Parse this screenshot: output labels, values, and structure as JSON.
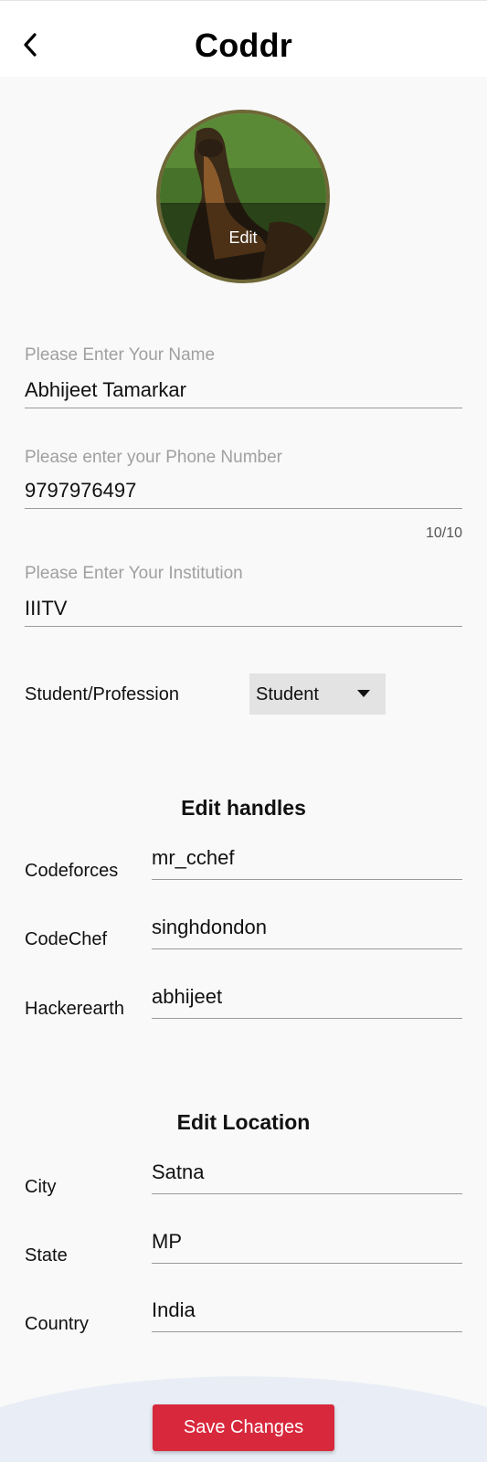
{
  "appbar": {
    "title": "Coddr",
    "back_icon": "back-arrow-icon"
  },
  "avatar": {
    "edit_label": "Edit"
  },
  "profile": {
    "name": {
      "label": "Please Enter Your Name",
      "value": "Abhijeet Tamarkar"
    },
    "phone": {
      "label": "Please enter your Phone Number",
      "value": "9797976497",
      "counter": "10/10"
    },
    "institution": {
      "label": "Please Enter Your Institution",
      "value": "IIITV"
    },
    "profession": {
      "label": "Student/Profession",
      "selected": "Student"
    }
  },
  "handles": {
    "title": "Edit handles",
    "items": [
      {
        "label": "Codeforces",
        "value": "mr_cchef"
      },
      {
        "label": "CodeChef",
        "value": "singhdondon"
      },
      {
        "label": "Hackerearth",
        "value": "abhijeet"
      }
    ]
  },
  "location": {
    "title": "Edit Location",
    "items": [
      {
        "label": "City",
        "value": "Satna"
      },
      {
        "label": "State",
        "value": "MP"
      },
      {
        "label": "Country",
        "value": "India"
      }
    ]
  },
  "actions": {
    "save_label": "Save Changes"
  },
  "colors": {
    "accent": "#d8283c",
    "avatar_border": "#6f6737",
    "dropdown_bg": "#e3e3e3"
  }
}
